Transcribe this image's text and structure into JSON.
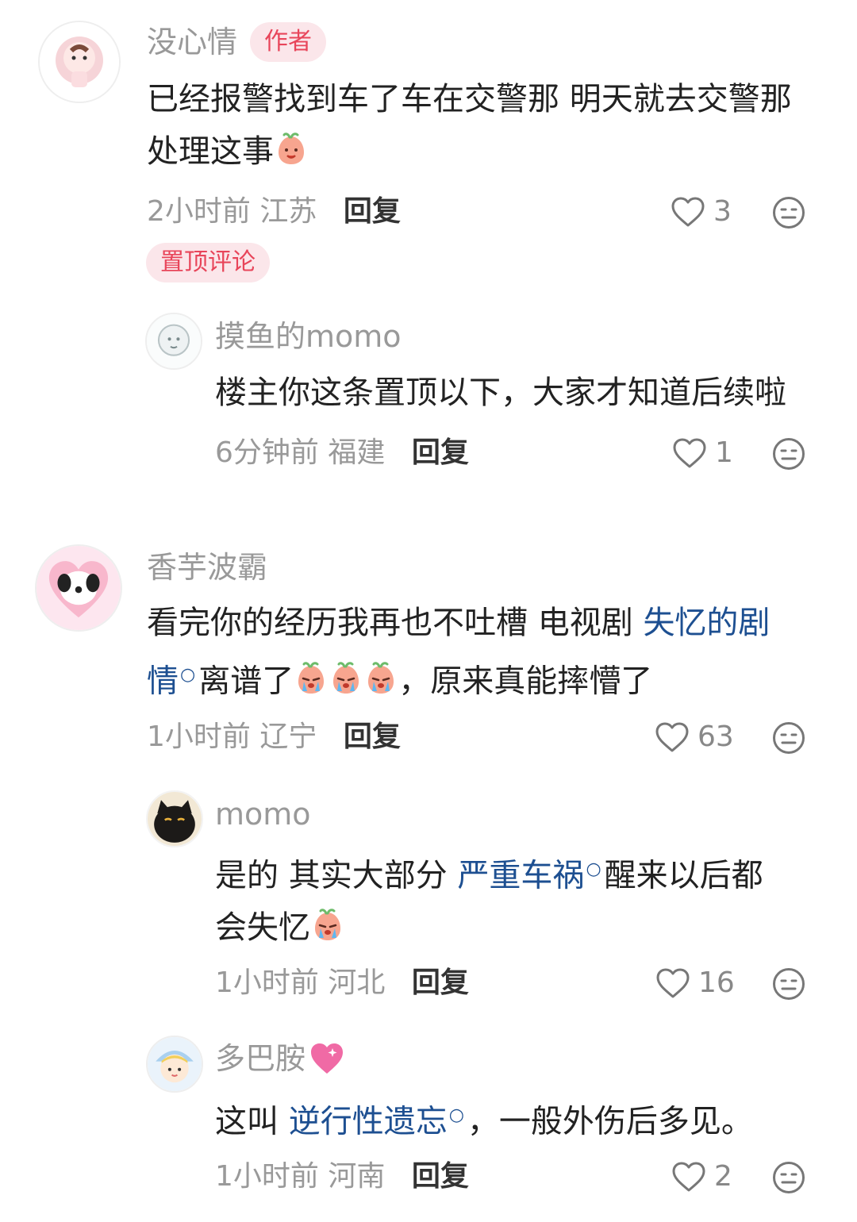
{
  "colors": {
    "accent": "#e8455a",
    "link": "#1d4f91",
    "meta": "#999999"
  },
  "comments": [
    {
      "name": "没心情",
      "badge": "作者",
      "text_parts": [
        "已经报警找到车了车在交警那 明天就去交警那",
        "处理这事"
      ],
      "time": "2小时前",
      "location": "江苏",
      "reply": "回复",
      "likes": "3",
      "pin": "置顶评论",
      "emoji": "peach-smile-emoji"
    },
    {
      "name": "摸鱼的momo",
      "text": "楼主你这条置顶以下，大家才知道后续啦",
      "time": "6分钟前",
      "location": "福建",
      "reply": "回复",
      "likes": "1"
    },
    {
      "name": "香芋波霸",
      "text_line1_plain": "看完你的经历我再也不吐槽 电视剧 ",
      "text_line1_link": "失忆的剧",
      "text_line2_link": "情",
      "text_line2_plain_a": "离谱了",
      "text_line2_plain_b": "，原来真能摔懵了",
      "time": "1小时前",
      "location": "辽宁",
      "reply": "回复",
      "likes": "63",
      "emoji": "peach-cry-emoji"
    },
    {
      "name": "momo",
      "text_line1_plain": "是的 其实大部分 ",
      "text_line1_link": "严重车祸",
      "text_line1_after": "醒来以后都",
      "text_line2_plain": "会失忆",
      "time": "1小时前",
      "location": "河北",
      "reply": "回复",
      "likes": "16",
      "emoji": "peach-cry-emoji"
    },
    {
      "name": "多巴胺",
      "name_emoji": "sparkling-heart-emoji",
      "text_plain_a": "这叫 ",
      "text_link": "逆行性遗忘",
      "text_plain_b": "，一般外伤后多见。",
      "time": "1小时前",
      "location": "河南",
      "reply": "回复",
      "likes": "2"
    }
  ]
}
